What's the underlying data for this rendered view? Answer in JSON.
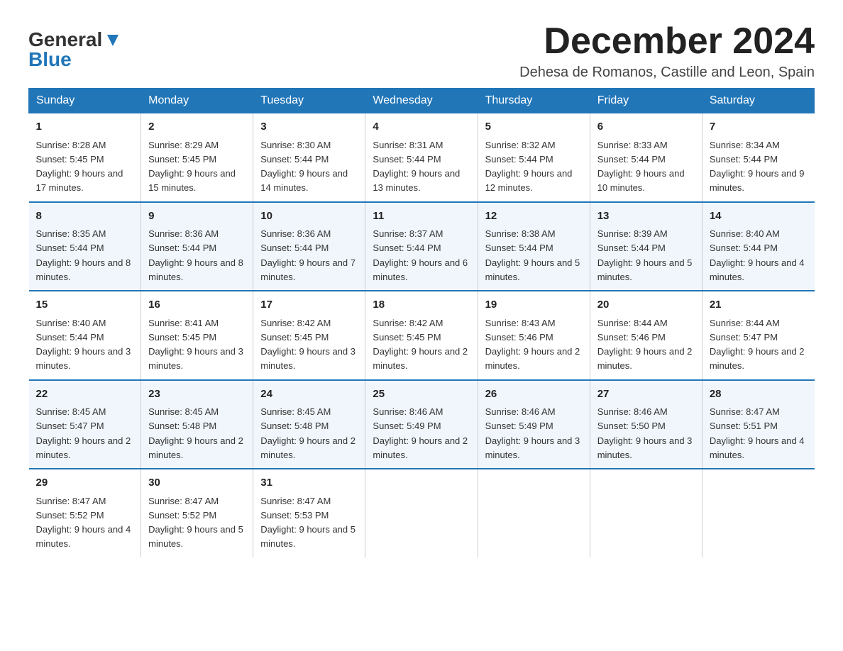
{
  "logo": {
    "general": "General",
    "blue": "Blue"
  },
  "header": {
    "month": "December 2024",
    "location": "Dehesa de Romanos, Castille and Leon, Spain"
  },
  "days_of_week": [
    "Sunday",
    "Monday",
    "Tuesday",
    "Wednesday",
    "Thursday",
    "Friday",
    "Saturday"
  ],
  "weeks": [
    [
      {
        "num": "1",
        "sunrise": "8:28 AM",
        "sunset": "5:45 PM",
        "daylight": "9 hours and 17 minutes."
      },
      {
        "num": "2",
        "sunrise": "8:29 AM",
        "sunset": "5:45 PM",
        "daylight": "9 hours and 15 minutes."
      },
      {
        "num": "3",
        "sunrise": "8:30 AM",
        "sunset": "5:44 PM",
        "daylight": "9 hours and 14 minutes."
      },
      {
        "num": "4",
        "sunrise": "8:31 AM",
        "sunset": "5:44 PM",
        "daylight": "9 hours and 13 minutes."
      },
      {
        "num": "5",
        "sunrise": "8:32 AM",
        "sunset": "5:44 PM",
        "daylight": "9 hours and 12 minutes."
      },
      {
        "num": "6",
        "sunrise": "8:33 AM",
        "sunset": "5:44 PM",
        "daylight": "9 hours and 10 minutes."
      },
      {
        "num": "7",
        "sunrise": "8:34 AM",
        "sunset": "5:44 PM",
        "daylight": "9 hours and 9 minutes."
      }
    ],
    [
      {
        "num": "8",
        "sunrise": "8:35 AM",
        "sunset": "5:44 PM",
        "daylight": "9 hours and 8 minutes."
      },
      {
        "num": "9",
        "sunrise": "8:36 AM",
        "sunset": "5:44 PM",
        "daylight": "9 hours and 8 minutes."
      },
      {
        "num": "10",
        "sunrise": "8:36 AM",
        "sunset": "5:44 PM",
        "daylight": "9 hours and 7 minutes."
      },
      {
        "num": "11",
        "sunrise": "8:37 AM",
        "sunset": "5:44 PM",
        "daylight": "9 hours and 6 minutes."
      },
      {
        "num": "12",
        "sunrise": "8:38 AM",
        "sunset": "5:44 PM",
        "daylight": "9 hours and 5 minutes."
      },
      {
        "num": "13",
        "sunrise": "8:39 AM",
        "sunset": "5:44 PM",
        "daylight": "9 hours and 5 minutes."
      },
      {
        "num": "14",
        "sunrise": "8:40 AM",
        "sunset": "5:44 PM",
        "daylight": "9 hours and 4 minutes."
      }
    ],
    [
      {
        "num": "15",
        "sunrise": "8:40 AM",
        "sunset": "5:44 PM",
        "daylight": "9 hours and 3 minutes."
      },
      {
        "num": "16",
        "sunrise": "8:41 AM",
        "sunset": "5:45 PM",
        "daylight": "9 hours and 3 minutes."
      },
      {
        "num": "17",
        "sunrise": "8:42 AM",
        "sunset": "5:45 PM",
        "daylight": "9 hours and 3 minutes."
      },
      {
        "num": "18",
        "sunrise": "8:42 AM",
        "sunset": "5:45 PM",
        "daylight": "9 hours and 2 minutes."
      },
      {
        "num": "19",
        "sunrise": "8:43 AM",
        "sunset": "5:46 PM",
        "daylight": "9 hours and 2 minutes."
      },
      {
        "num": "20",
        "sunrise": "8:44 AM",
        "sunset": "5:46 PM",
        "daylight": "9 hours and 2 minutes."
      },
      {
        "num": "21",
        "sunrise": "8:44 AM",
        "sunset": "5:47 PM",
        "daylight": "9 hours and 2 minutes."
      }
    ],
    [
      {
        "num": "22",
        "sunrise": "8:45 AM",
        "sunset": "5:47 PM",
        "daylight": "9 hours and 2 minutes."
      },
      {
        "num": "23",
        "sunrise": "8:45 AM",
        "sunset": "5:48 PM",
        "daylight": "9 hours and 2 minutes."
      },
      {
        "num": "24",
        "sunrise": "8:45 AM",
        "sunset": "5:48 PM",
        "daylight": "9 hours and 2 minutes."
      },
      {
        "num": "25",
        "sunrise": "8:46 AM",
        "sunset": "5:49 PM",
        "daylight": "9 hours and 2 minutes."
      },
      {
        "num": "26",
        "sunrise": "8:46 AM",
        "sunset": "5:49 PM",
        "daylight": "9 hours and 3 minutes."
      },
      {
        "num": "27",
        "sunrise": "8:46 AM",
        "sunset": "5:50 PM",
        "daylight": "9 hours and 3 minutes."
      },
      {
        "num": "28",
        "sunrise": "8:47 AM",
        "sunset": "5:51 PM",
        "daylight": "9 hours and 4 minutes."
      }
    ],
    [
      {
        "num": "29",
        "sunrise": "8:47 AM",
        "sunset": "5:52 PM",
        "daylight": "9 hours and 4 minutes."
      },
      {
        "num": "30",
        "sunrise": "8:47 AM",
        "sunset": "5:52 PM",
        "daylight": "9 hours and 5 minutes."
      },
      {
        "num": "31",
        "sunrise": "8:47 AM",
        "sunset": "5:53 PM",
        "daylight": "9 hours and 5 minutes."
      },
      null,
      null,
      null,
      null
    ]
  ]
}
